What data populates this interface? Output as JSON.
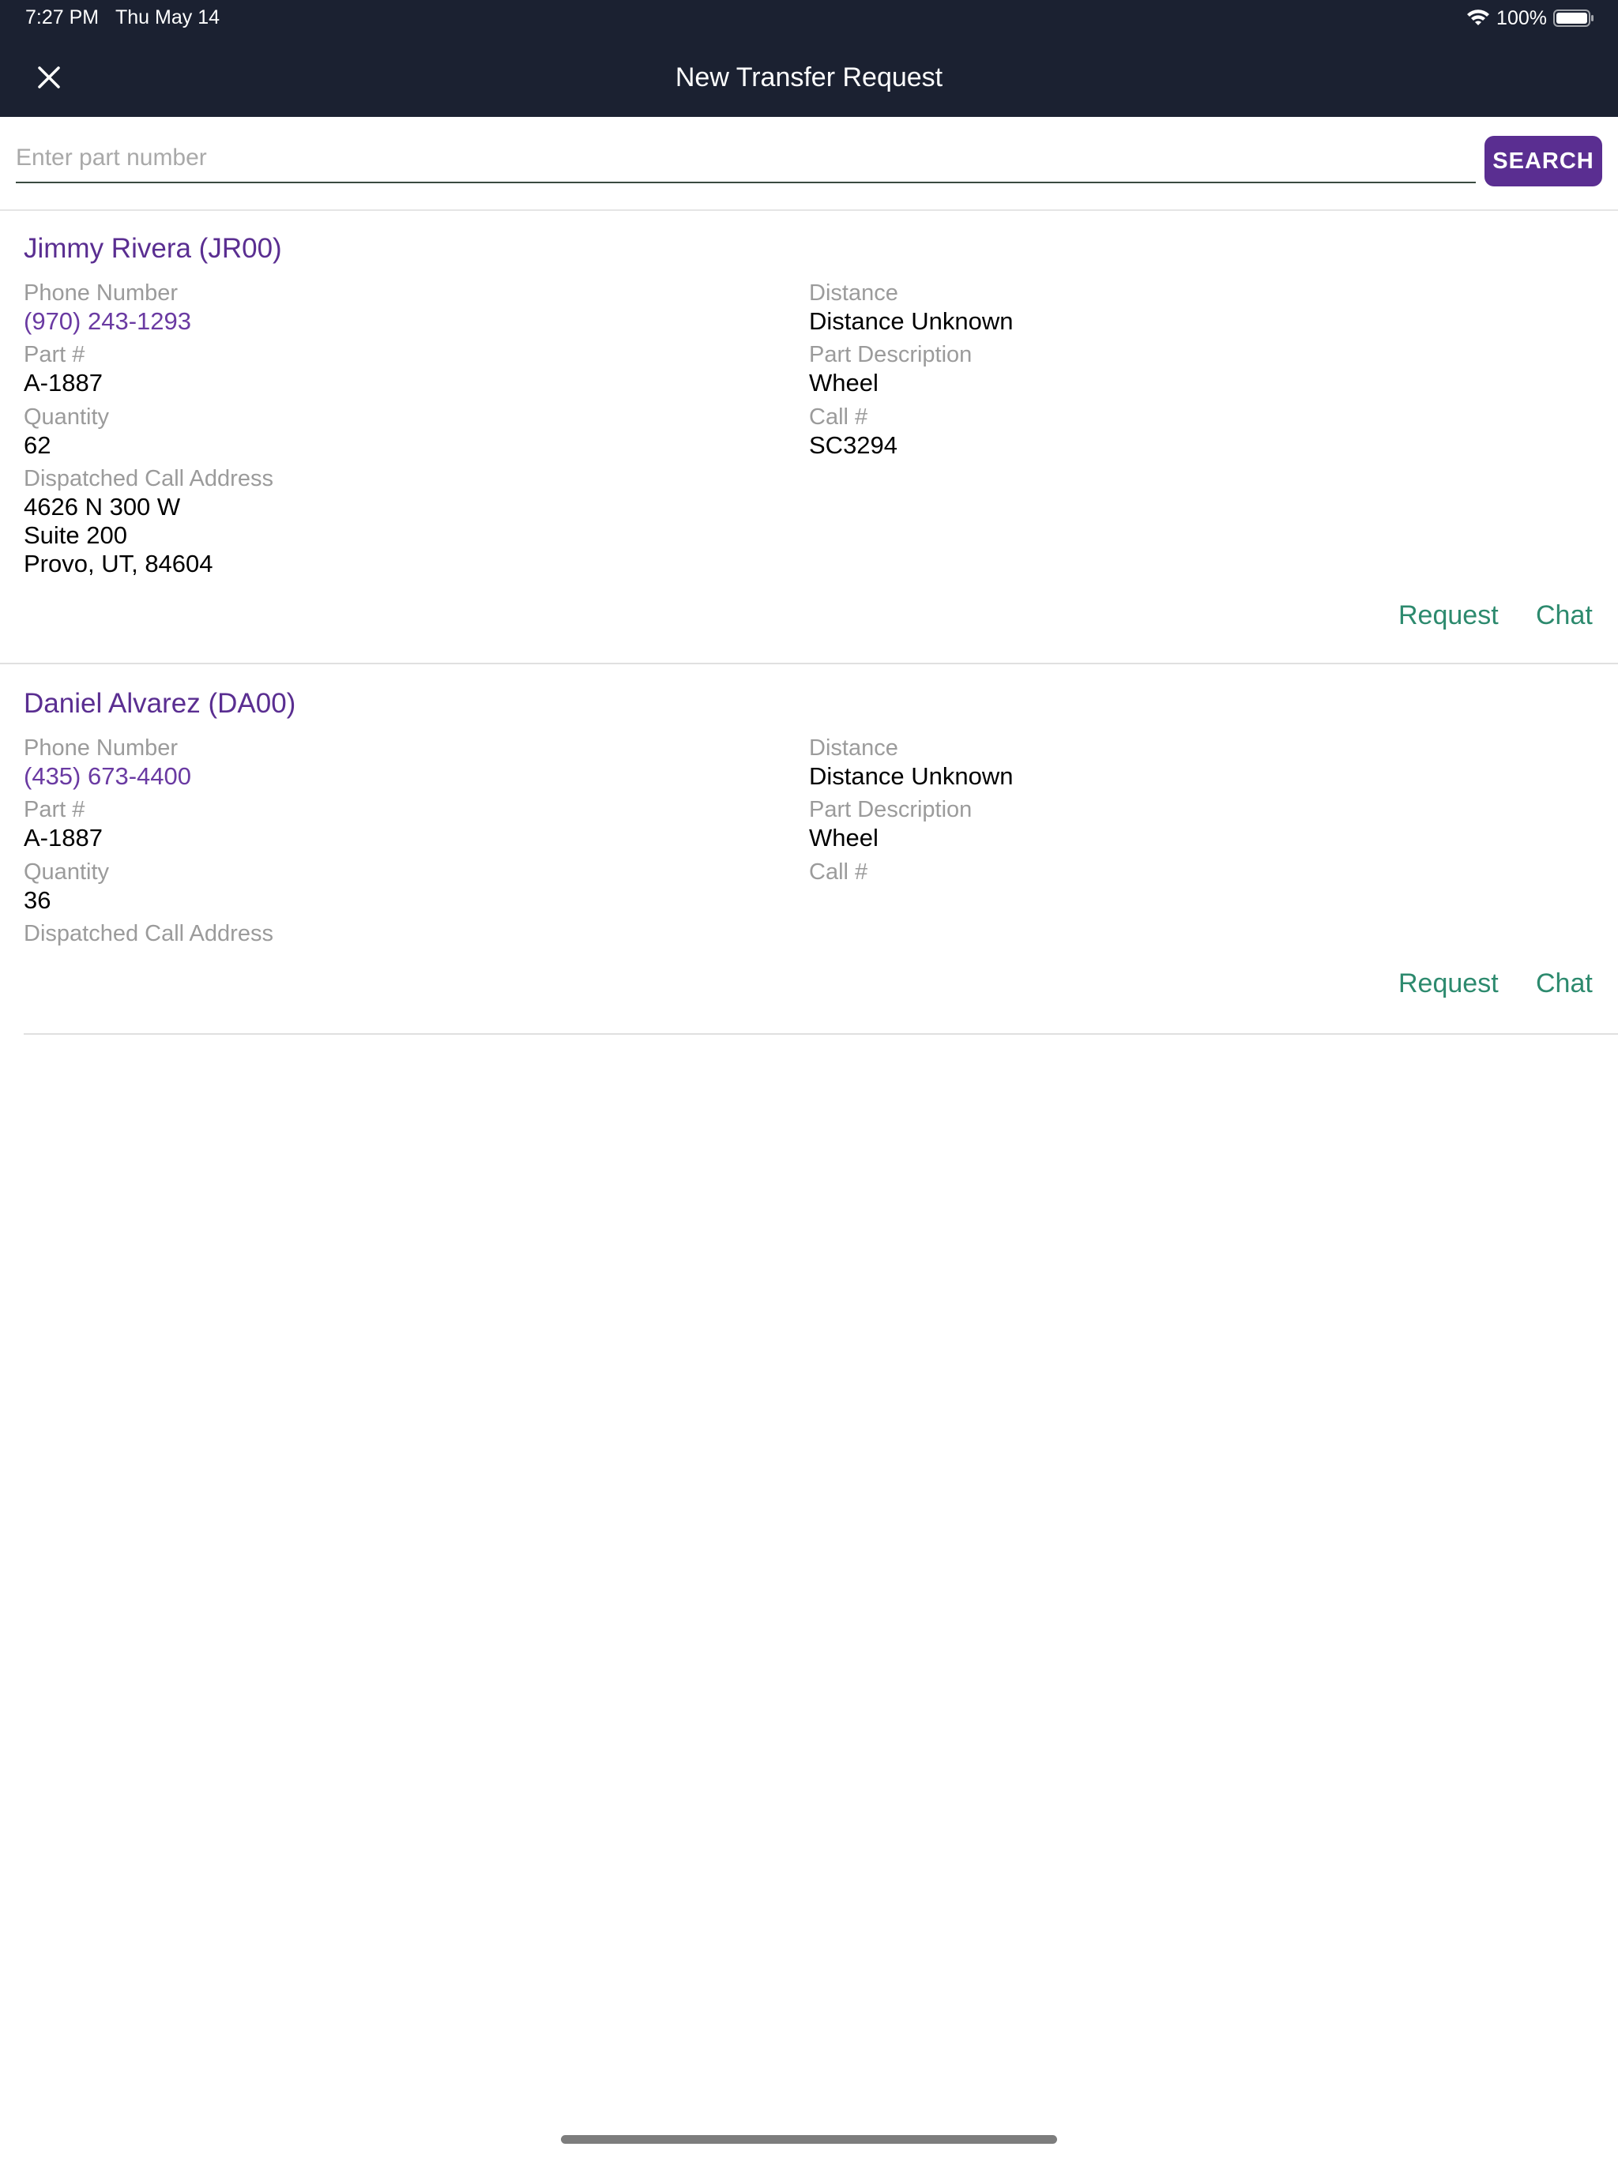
{
  "status_bar": {
    "time": "7:27 PM",
    "date": "Thu May 14",
    "battery": "100%"
  },
  "header": {
    "title": "New Transfer Request"
  },
  "search": {
    "placeholder": "Enter part number",
    "value": "",
    "button_label": "SEARCH"
  },
  "labels": {
    "phone": "Phone Number",
    "part_number": "Part #",
    "quantity": "Quantity",
    "address": "Dispatched Call Address",
    "distance": "Distance",
    "part_description": "Part Description",
    "call_number": "Call #",
    "request": "Request",
    "chat": "Chat"
  },
  "results": [
    {
      "name": "Jimmy Rivera (JR00)",
      "phone": "(970) 243-1293",
      "part_number": "A-1887",
      "quantity": "62",
      "address": [
        "4626 N 300 W",
        "Suite 200",
        "Provo, UT, 84604"
      ],
      "distance": "Distance Unknown",
      "part_description": "Wheel",
      "call_number": "SC3294"
    },
    {
      "name": "Daniel Alvarez (DA00)",
      "phone": "(435) 673-4400",
      "part_number": "A-1887",
      "quantity": "36",
      "address": [],
      "distance": "Distance Unknown",
      "part_description": "Wheel",
      "call_number": ""
    }
  ],
  "colors": {
    "header_bg": "#1b2131",
    "accent_purple": "#5a2e91",
    "action_green": "#2d8a6e",
    "label_gray": "#9b9b9b"
  }
}
